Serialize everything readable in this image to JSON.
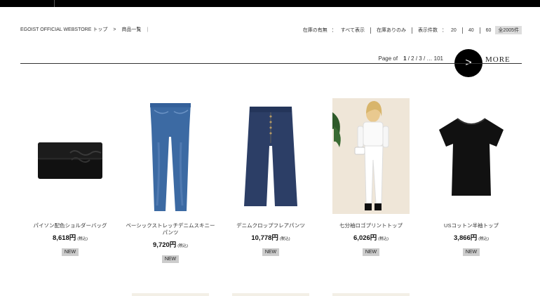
{
  "breadcrumb": {
    "home": "EGOIST OFFICIAL WEBSTORE トップ",
    "separator": ">",
    "current": "商品一覧",
    "pipe": "|"
  },
  "filters": {
    "stock_label": "在庫の有無",
    "colon": "：",
    "all": "すべて表示",
    "in_stock": "在庫ありのみ",
    "per_page_label": "表示件数",
    "per_page_options": [
      "20",
      "40",
      "60"
    ],
    "total": "全2005件"
  },
  "pager": {
    "label": "Page of",
    "current": "1",
    "rest": " / 2 / 3 / … 101"
  },
  "more": {
    "arrow": ">",
    "label": "MORE"
  },
  "products": [
    {
      "name": "パイソン配色ショルダーバッグ",
      "price": "8,618円",
      "tax": "(税込)",
      "badge": "NEW",
      "icon": "clutch-bag-icon"
    },
    {
      "name": "ベーシックストレッチデニムスキニーパンツ",
      "price": "9,720円",
      "tax": "(税込)",
      "badge": "NEW",
      "icon": "skinny-jeans-icon"
    },
    {
      "name": "デニムクロップフレアパンツ",
      "price": "10,778円",
      "tax": "(税込)",
      "badge": "NEW",
      "icon": "flare-jeans-icon"
    },
    {
      "name": "七分袖ロゴプリントトップ",
      "price": "6,026円",
      "tax": "(税込)",
      "badge": "NEW",
      "icon": "model-photo-icon"
    },
    {
      "name": "USコットン半袖トップ",
      "price": "3,866円",
      "tax": "(税込)",
      "badge": "NEW",
      "icon": "tshirt-icon"
    }
  ],
  "colors": {
    "topbar": "#000000",
    "badge_bg": "#cccccc",
    "denim": "#3c6aa3",
    "dark_denim": "#2c3e66"
  }
}
